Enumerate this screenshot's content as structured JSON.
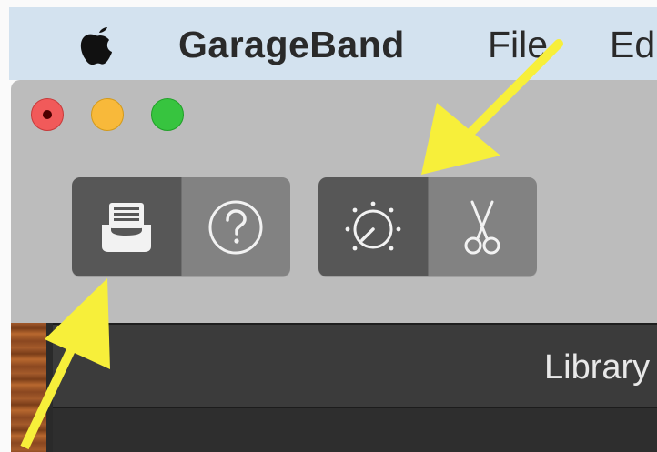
{
  "menubar": {
    "app_name": "GarageBand",
    "items": [
      "File",
      "Edi"
    ]
  },
  "window": {
    "traffic_lights": [
      "close",
      "minimize",
      "zoom"
    ],
    "toolbar": {
      "left_group": [
        {
          "icon": "library-tray-icon",
          "state": "active"
        },
        {
          "icon": "help-question-icon",
          "state": "inactive"
        }
      ],
      "right_group": [
        {
          "icon": "smart-controls-knob-icon",
          "state": "active"
        },
        {
          "icon": "editors-scissors-icon",
          "state": "inactive"
        }
      ]
    },
    "library_header": "Library"
  },
  "annotations": {
    "arrow_color": "#f7ef3a",
    "arrows": [
      "arrow-to-smart-controls",
      "arrow-to-library-button"
    ]
  },
  "colors": {
    "menubar": "#d3e2ef",
    "window_bg": "#bcbcbc",
    "button_active": "#575757",
    "button_inactive": "#828282",
    "close": "#f15a5a",
    "minimize": "#f8b93a",
    "zoom": "#37c43f"
  }
}
